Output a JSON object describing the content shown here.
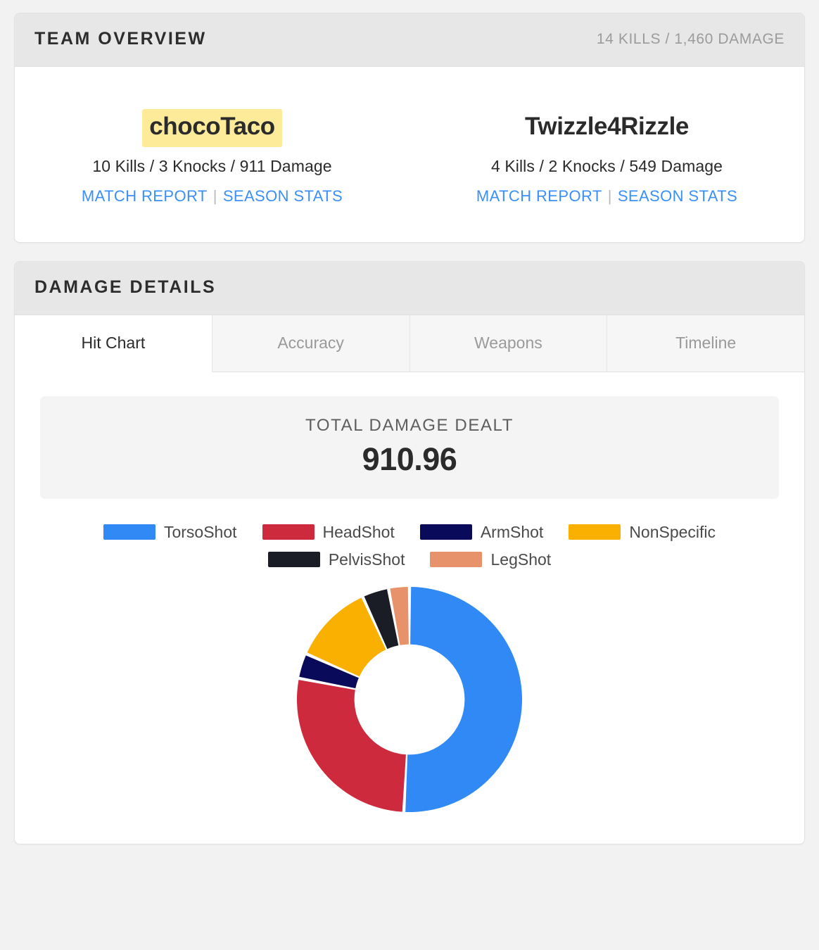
{
  "team_overview": {
    "title": "TEAM OVERVIEW",
    "summary": "14 KILLS / 1,460 DAMAGE",
    "players": [
      {
        "name": "chocoTaco",
        "highlighted": true,
        "stats": "10 Kills / 3 Knocks / 911 Damage",
        "match_report_label": "MATCH REPORT",
        "separator": "|",
        "season_stats_label": "SEASON STATS"
      },
      {
        "name": "Twizzle4Rizzle",
        "highlighted": false,
        "stats": "4 Kills / 2 Knocks / 549 Damage",
        "match_report_label": "MATCH REPORT",
        "separator": "|",
        "season_stats_label": "SEASON STATS"
      }
    ]
  },
  "damage_details": {
    "title": "DAMAGE DETAILS",
    "tabs": [
      {
        "label": "Hit Chart",
        "active": true
      },
      {
        "label": "Accuracy",
        "active": false
      },
      {
        "label": "Weapons",
        "active": false
      },
      {
        "label": "Timeline",
        "active": false
      }
    ],
    "total": {
      "label": "TOTAL DAMAGE DEALT",
      "value": "910.96"
    }
  },
  "chart_data": {
    "type": "pie",
    "variant": "donut",
    "title": "TOTAL DAMAGE DEALT",
    "total": 910.96,
    "legend_position": "top",
    "start_angle_deg": 0,
    "direction": "clockwise",
    "inner_radius_ratio": 0.49,
    "categories": [
      "TorsoShot",
      "HeadShot",
      "ArmShot",
      "NonSpecific",
      "PelvisShot",
      "LegShot"
    ],
    "values": [
      462.8,
      247.9,
      32.9,
      105.3,
      34.9,
      27.2
    ],
    "percentages": [
      50.8,
      27.2,
      3.6,
      11.6,
      3.8,
      3.0
    ],
    "angles_deg": [
      183.0,
      98.0,
      13.0,
      41.6,
      13.8,
      10.6
    ],
    "colors": [
      "#3089f5",
      "#cd2a3e",
      "#0a0a5a",
      "#f9b000",
      "#1b1d26",
      "#e8926b"
    ],
    "slices": [
      {
        "name": "TorsoShot",
        "value": 462.8,
        "percent": 50.8,
        "color": "#3089f5"
      },
      {
        "name": "HeadShot",
        "value": 247.9,
        "percent": 27.2,
        "color": "#cd2a3e"
      },
      {
        "name": "ArmShot",
        "value": 32.9,
        "percent": 3.6,
        "color": "#0a0a5a"
      },
      {
        "name": "NonSpecific",
        "value": 105.3,
        "percent": 11.6,
        "color": "#f9b000"
      },
      {
        "name": "PelvisShot",
        "value": 34.9,
        "percent": 3.8,
        "color": "#1b1d26"
      },
      {
        "name": "LegShot",
        "value": 27.2,
        "percent": 3.0,
        "color": "#e8926b"
      }
    ],
    "legend_rows": [
      [
        "TorsoShot",
        "HeadShot",
        "ArmShot",
        "NonSpecific"
      ],
      [
        "PelvisShot",
        "LegShot"
      ]
    ]
  }
}
